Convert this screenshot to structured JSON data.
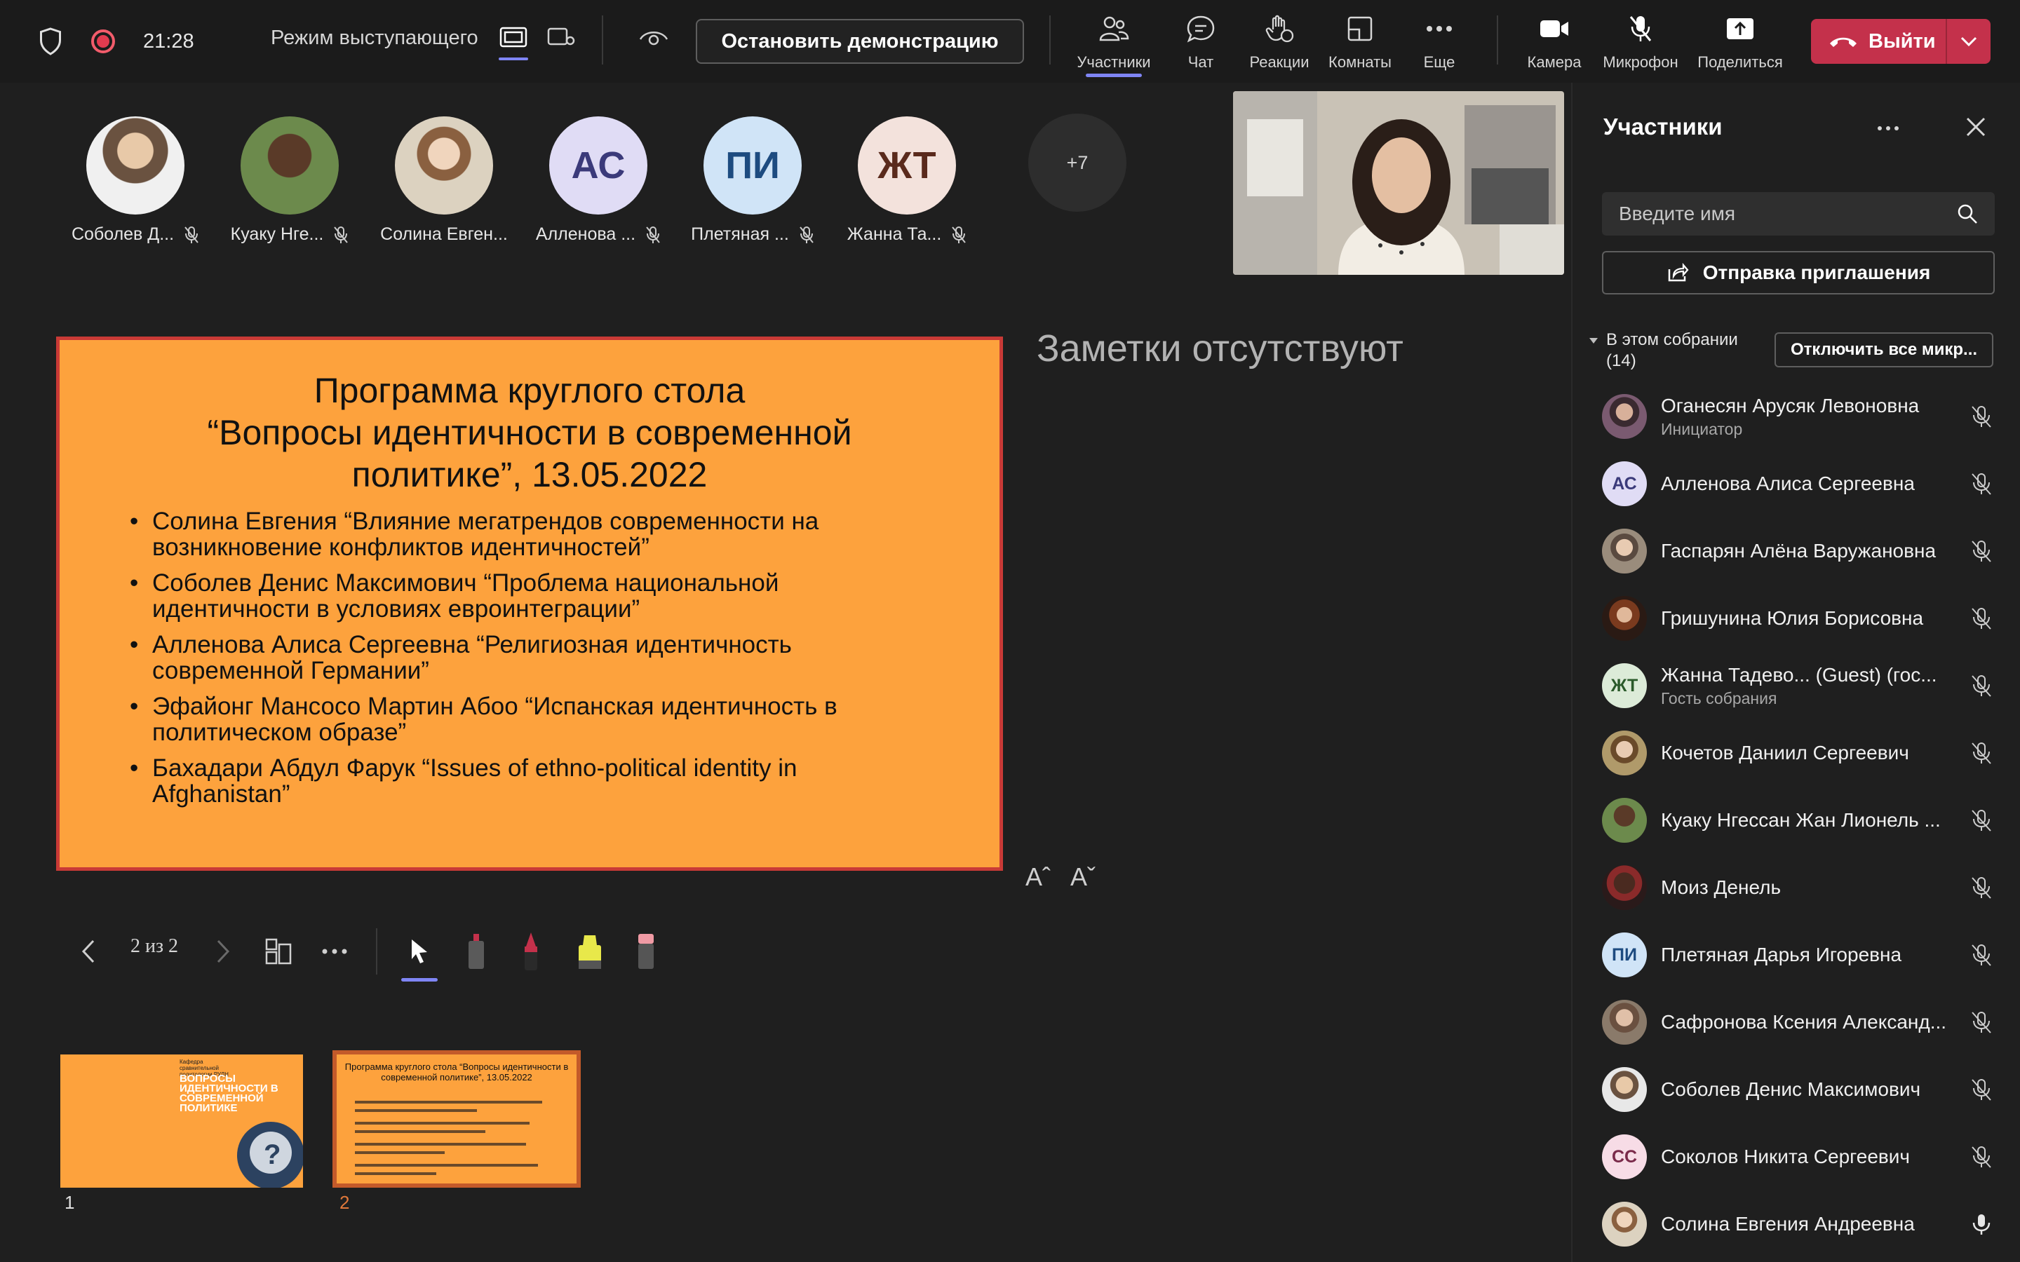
{
  "topbar": {
    "time": "21:28",
    "mode_label": "Режим выступающего",
    "stop_label": "Остановить демонстрацию",
    "tools": [
      {
        "label": "Участники",
        "icon": "participants-icon"
      },
      {
        "label": "Чат",
        "icon": "chat-icon"
      },
      {
        "label": "Реакции",
        "icon": "reactions-icon"
      },
      {
        "label": "Комнаты",
        "icon": "rooms-icon"
      },
      {
        "label": "Еще",
        "icon": "more-icon"
      },
      {
        "label": "Камера",
        "icon": "camera-icon"
      },
      {
        "label": "Микрофон",
        "icon": "mic-off-icon"
      },
      {
        "label": "Поделиться",
        "icon": "share-icon"
      }
    ],
    "leave_label": "Выйти",
    "colors": {
      "accent": "#7f85f5",
      "leave": "#c4314b",
      "record": "#e23b4f"
    }
  },
  "strip": {
    "participants": [
      {
        "name": "Соболев Д...",
        "initials": "",
        "color": "#8a6a52"
      },
      {
        "name": "Куаку Нге...",
        "initials": "",
        "color": "#5a7a45"
      },
      {
        "name": "Солина Евген...",
        "initials": "",
        "color": "#c9b8a0"
      },
      {
        "name": "Алленова ...",
        "initials": "АС",
        "color": "#e0dcf5"
      },
      {
        "name": "Плетяная ...",
        "initials": "ПИ",
        "color": "#d0e4f7"
      },
      {
        "name": "Жанна Та...",
        "initials": "ЖТ",
        "color": "#f3e2dc"
      }
    ],
    "more_label": "+7"
  },
  "slide": {
    "title_lines": [
      "Программа круглого стола",
      "“Вопросы идентичности в современной",
      "политике”, 13.05.2022"
    ],
    "bullets": [
      "Солина Евгения “Влияние мегатрендов современности на возникновение конфликтов идентичностей”",
      "Соболев Денис Максимович “Проблема национальной идентичности в условиях евроинтеграции”",
      "Алленова Алиса Сергеевна “Религиозная идентичность современной Германии”",
      "Эфайонг Мансосо Мартин Абоо “Испанская идентичность в политическом образе”",
      "Бахадари Абдул Фарук “Issues of ethno-political identity in Afghanistan”"
    ]
  },
  "notes": {
    "text": "Заметки отсутствуют",
    "increase_label": "Aˆ",
    "decrease_label": "Aˇ"
  },
  "controls": {
    "page_indicator": "2 из 2"
  },
  "thumbnails": [
    {
      "number": "1",
      "text": "ВОПРОСЫ ИДЕНТИЧНОСТИ В СОВРЕМЕННОЙ ПОЛИТИКЕ",
      "header": "Кафедра сравнительной политологии РУДН"
    },
    {
      "number": "2",
      "text": "Программа круглого стола “Вопросы идентичности в современной политике”, 13.05.2022"
    }
  ],
  "panel": {
    "title": "Участники",
    "search_placeholder": "Введите имя",
    "invite_label": "Отправка приглашения",
    "section_label": "В этом собрании (14)",
    "mute_all_label": "Отключить все микр...",
    "people": [
      {
        "name": "Оганесян Арусяк Левоновна",
        "sub": "Инициатор",
        "initials": "",
        "color": "#6a4a5a",
        "mic": "off"
      },
      {
        "name": "Алленова Алиса Сергеевна",
        "sub": "",
        "initials": "АС",
        "color": "#e0dcf5",
        "mic": "off"
      },
      {
        "name": "Гаспарян Алёна Варужановна",
        "sub": "",
        "initials": "",
        "color": "#8c7c6c",
        "mic": "off"
      },
      {
        "name": "Гришунина Юлия Борисовна",
        "sub": "",
        "initials": "",
        "color": "#5a3a2a",
        "mic": "off"
      },
      {
        "name": "Жанна Тадево...  (Guest) (гос...",
        "sub": "Гость собрания",
        "initials": "ЖТ",
        "color": "#dcebd8",
        "mic": "off"
      },
      {
        "name": "Кочетов Даниил Сергеевич",
        "sub": "",
        "initials": "",
        "color": "#a08a60",
        "mic": "off"
      },
      {
        "name": "Куаку Нгессан Жан Лионель ...",
        "sub": "",
        "initials": "",
        "color": "#5a7a45",
        "mic": "off"
      },
      {
        "name": "Моиз Денель",
        "sub": "",
        "initials": "",
        "color": "#6a2a2a",
        "mic": "off"
      },
      {
        "name": "Плетяная Дарья Игоревна",
        "sub": "",
        "initials": "ПИ",
        "color": "#d0e4f7",
        "mic": "off"
      },
      {
        "name": "Сафронова Ксения Александ...",
        "sub": "",
        "initials": "",
        "color": "#7a6a5a",
        "mic": "off"
      },
      {
        "name": "Соболев Денис Максимович",
        "sub": "",
        "initials": "",
        "color": "#8a6a52",
        "mic": "off"
      },
      {
        "name": "Соколов Никита Сергеевич",
        "sub": "",
        "initials": "СС",
        "color": "#f7dce6",
        "mic": "off"
      },
      {
        "name": "Солина Евгения Андреевна",
        "sub": "",
        "initials": "",
        "color": "#c9b8a0",
        "mic": "on"
      }
    ]
  }
}
